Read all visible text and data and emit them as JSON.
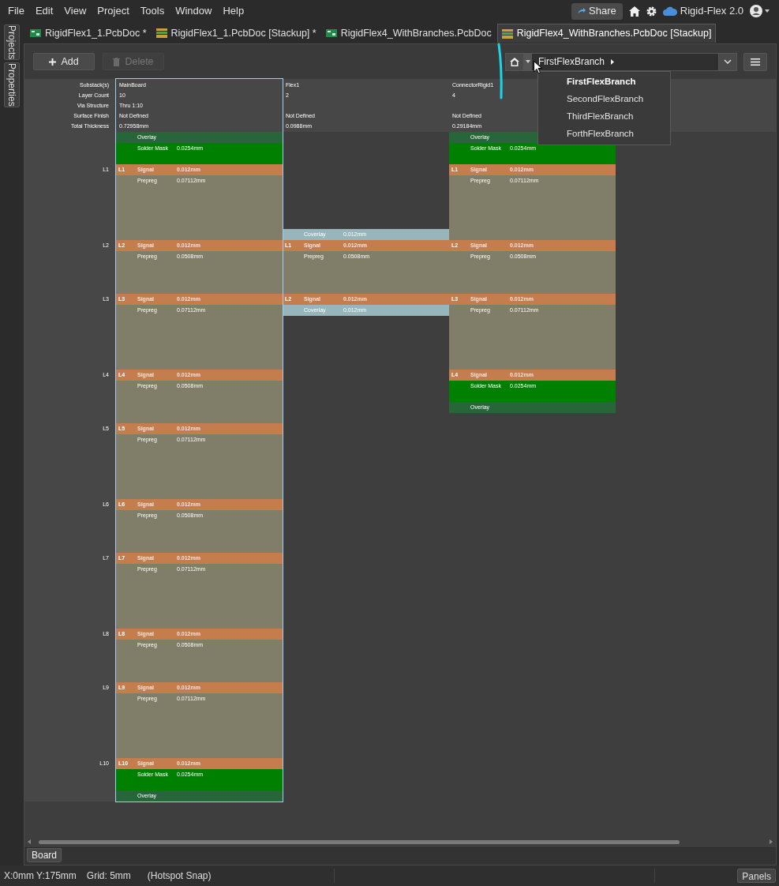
{
  "menu": [
    "File",
    "Edit",
    "View",
    "Project",
    "Tools",
    "Window",
    "Help"
  ],
  "share": "Share",
  "project": "Rigid-Flex 2.0",
  "tabs": [
    {
      "label": "RigidFlex1_1.PcbDoc *",
      "kind": "pcb",
      "selected": false
    },
    {
      "label": "RigidFlex1_1.PcbDoc [Stackup] *",
      "kind": "stackup",
      "selected": false
    },
    {
      "label": "RigidFlex4_WithBranches.PcbDoc",
      "kind": "pcb",
      "selected": false
    },
    {
      "label": "RigidFlex4_WithBranches.PcbDoc [Stackup]",
      "kind": "stackup",
      "selected": true
    }
  ],
  "side_panels": [
    "Projects",
    "Properties"
  ],
  "actions": [
    {
      "label": "Add",
      "kind": "add",
      "disabled": false
    },
    {
      "label": "Delete",
      "kind": "delete",
      "disabled": true
    }
  ],
  "branch": {
    "current": "FirstFlexBranch",
    "options": [
      {
        "label": "FirstFlexBranch",
        "selected": true
      },
      {
        "label": "SecondFlexBranch",
        "selected": false
      },
      {
        "label": "ThirdFlexBranch",
        "selected": false
      },
      {
        "label": "ForthFlexBranch",
        "selected": false
      }
    ]
  },
  "header_labels": [
    "Substack(s)",
    "Layer Count",
    "Via Structure",
    "Surface Finish",
    "Total Thickness"
  ],
  "substacks": [
    {
      "selected": true,
      "fields": {
        "name": "MainBoard",
        "layer_count": "10",
        "via_structure": "Thru 1:10",
        "surface_finish": "Not Defined",
        "total_thickness": "0.72958mm"
      },
      "layers": [
        {
          "kind": "overlay",
          "name": "Overlay"
        },
        {
          "kind": "solder_mask",
          "name": "Solder Mask",
          "thickness": "0.0254mm"
        },
        {
          "kind": "signal",
          "number": "L1",
          "ruler": "L1",
          "name": "Signal",
          "thickness": "0.012mm"
        },
        {
          "kind": "prepreg",
          "name": "Prepreg",
          "thickness": "0.07112mm"
        },
        {
          "kind": "signal",
          "number": "L2",
          "ruler": "L2",
          "name": "Signal",
          "thickness": "0.012mm"
        },
        {
          "kind": "prepreg",
          "name": "Prepreg",
          "thickness": "0.0508mm"
        },
        {
          "kind": "signal",
          "number": "L3",
          "ruler": "L3",
          "name": "Signal",
          "thickness": "0.012mm"
        },
        {
          "kind": "prepreg",
          "name": "Prepreg",
          "thickness": "0.07112mm"
        },
        {
          "kind": "signal",
          "number": "L4",
          "ruler": "L4",
          "name": "Signal",
          "thickness": "0.012mm"
        },
        {
          "kind": "prepreg",
          "name": "Prepreg",
          "thickness": "0.0508mm"
        },
        {
          "kind": "signal",
          "number": "L5",
          "ruler": "L5",
          "name": "Signal",
          "thickness": "0.012mm"
        },
        {
          "kind": "prepreg",
          "name": "Prepreg",
          "thickness": "0.07112mm"
        },
        {
          "kind": "signal",
          "number": "L6",
          "ruler": "L6",
          "name": "Signal",
          "thickness": "0.012mm"
        },
        {
          "kind": "prepreg",
          "name": "Prepreg",
          "thickness": "0.0508mm"
        },
        {
          "kind": "signal",
          "number": "L7",
          "ruler": "L7",
          "name": "Signal",
          "thickness": "0.012mm"
        },
        {
          "kind": "prepreg",
          "name": "Prepreg",
          "thickness": "0.07112mm"
        },
        {
          "kind": "signal",
          "number": "L8",
          "ruler": "L8",
          "name": "Signal",
          "thickness": "0.012mm"
        },
        {
          "kind": "prepreg",
          "name": "Prepreg",
          "thickness": "0.0508mm"
        },
        {
          "kind": "signal",
          "number": "L9",
          "ruler": "L9",
          "name": "Signal",
          "thickness": "0.012mm"
        },
        {
          "kind": "prepreg",
          "name": "Prepreg",
          "thickness": "0.07112mm"
        },
        {
          "kind": "signal",
          "number": "L10",
          "ruler": "L10",
          "name": "Signal",
          "thickness": "0.012mm"
        },
        {
          "kind": "solder_mask",
          "name": "Solder Mask",
          "thickness": "0.0254mm"
        },
        {
          "kind": "overlay",
          "name": "Overlay"
        }
      ]
    },
    {
      "selected": false,
      "fields": {
        "name": "Flex1",
        "layer_count": "2",
        "surface_finish": "Not Defined",
        "total_thickness": "0.0988mm"
      },
      "layers": [
        {
          "kind": "coverlay",
          "name": "Coverlay",
          "thickness": "0.012mm"
        },
        {
          "kind": "signal",
          "number": "L1",
          "name": "Signal",
          "thickness": "0.012mm"
        },
        {
          "kind": "prepreg",
          "name": "Prepreg",
          "thickness": "0.0508mm"
        },
        {
          "kind": "signal",
          "number": "L2",
          "name": "Signal",
          "thickness": "0.012mm"
        },
        {
          "kind": "coverlay",
          "name": "Coverlay",
          "thickness": "0.012mm"
        }
      ]
    },
    {
      "selected": false,
      "fields": {
        "name": "ConnectorRigid1",
        "layer_count": "4",
        "surface_finish": "Not Defined",
        "total_thickness": "0.29184mm"
      },
      "layers": [
        {
          "kind": "overlay",
          "name": "Overlay"
        },
        {
          "kind": "solder_mask",
          "name": "Solder Mask",
          "thickness": "0.0254mm"
        },
        {
          "kind": "signal",
          "number": "L1",
          "name": "Signal",
          "thickness": "0.012mm"
        },
        {
          "kind": "prepreg",
          "name": "Prepreg",
          "thickness": "0.07112mm"
        },
        {
          "kind": "signal",
          "number": "L2",
          "name": "Signal",
          "thickness": "0.012mm"
        },
        {
          "kind": "prepreg",
          "name": "Prepreg",
          "thickness": "0.0508mm"
        },
        {
          "kind": "signal",
          "number": "L3",
          "name": "Signal",
          "thickness": "0.012mm"
        },
        {
          "kind": "prepreg",
          "name": "Prepreg",
          "thickness": "0.07112mm"
        },
        {
          "kind": "signal",
          "number": "L4",
          "name": "Signal",
          "thickness": "0.012mm"
        },
        {
          "kind": "solder_mask",
          "name": "Solder Mask",
          "thickness": "0.0254mm"
        },
        {
          "kind": "overlay",
          "name": "Overlay"
        }
      ]
    }
  ],
  "sheet_tabs": [
    "Board"
  ],
  "status": [
    "X:0mm Y:175mm",
    "Grid: 5mm",
    "(Hotspot Snap)"
  ],
  "panels_button": "Panels"
}
